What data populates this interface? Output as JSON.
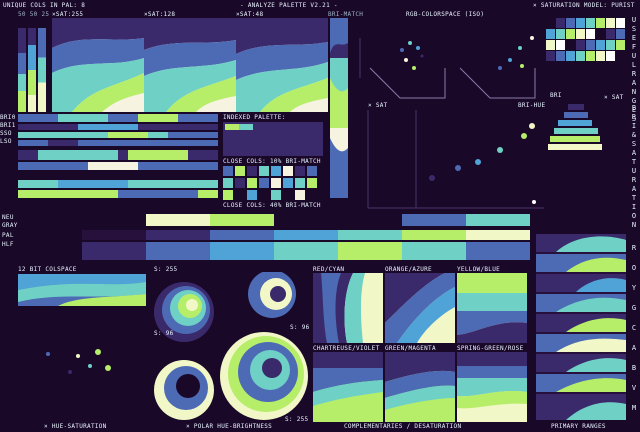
{
  "header": {
    "unique_cols": "UNIQUE COLS IN PAL: 8",
    "title": "- ANALYZE PALETTE V2.21 -",
    "saturation_model": "× SATURATION MODEL: PURIST",
    "sat_labels": [
      "50 50 25",
      "×SAT:255",
      "×SAT:128",
      "×SAT:48",
      "BRI-MATCH",
      "RGB-COLORSPACE (ISO)"
    ]
  },
  "panels": {
    "indexed_palette": "INDEXED PALETTE:",
    "close_10": "CLOSE COLS: 10% BRI-MATCH",
    "close_40": "CLOSE COLS: 40% BRI-MATCH",
    "sat": "× SAT",
    "bri_hue": "BRI-HUE",
    "bri": "BRI",
    "twelve_bit": "12 BIT COLSPACE",
    "s255": "S: 255",
    "s96a": "S: 96",
    "s96b": "S: 96",
    "s255b": "S: 255",
    "left_side_labels": [
      "BRI0",
      "BRI1",
      "SSO",
      "LSO"
    ],
    "row_labels": [
      "NEU",
      "GRAY",
      "PAL",
      "HLF"
    ]
  },
  "complementary_pairs": [
    "RED/CYAN",
    "ORANGE/AZURE",
    "YELLOW/BLUE",
    "CHARTREUSE/VIOLET",
    "GREEN/MAGENTA",
    "SPRING-GREEN/ROSE"
  ],
  "side_vertical": {
    "useful_ranges": "USEFUL RANGES",
    "bri_sat": "BRI & SATURATION",
    "hues": "ROYGCABVM"
  },
  "footer": {
    "hue_sat": "× HUE-SATURATION",
    "polar": "× POLAR HUE-BRIGHTNESS",
    "complementaries": "COMPLEMENTARIES / DESATURATION",
    "primary_ranges": "PRIMARY RANGES"
  },
  "palette": [
    "#1a0829",
    "#3b2a6b",
    "#4d6ab5",
    "#4fa3d6",
    "#6fd1c6",
    "#b6ee6a",
    "#f2f7c8",
    "#ffffff"
  ]
}
